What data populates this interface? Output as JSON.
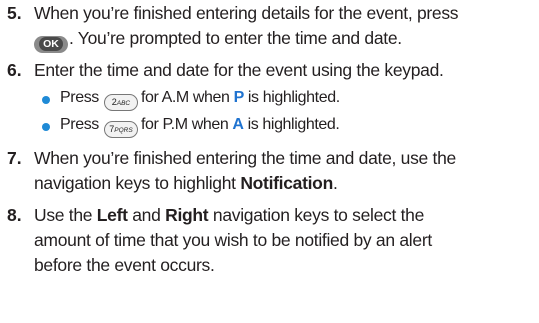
{
  "steps": [
    {
      "number": "5.",
      "lines": [
        "When you’re finished entering details for the event, press",
        ". You’re prompted to enter the time and date."
      ],
      "ok_key_label": "OK"
    },
    {
      "number": "6.",
      "lines": [
        "Enter the time and date for the event using the keypad."
      ],
      "bullets": [
        {
          "before": "Press",
          "key_label": "2",
          "key_letters": "ABC",
          "middle": "for A.M when",
          "highlight": "P",
          "after": "is highlighted."
        },
        {
          "before": "Press",
          "key_label": "7",
          "key_letters": "PQRS",
          "middle": "for P.M when",
          "highlight": "A",
          "after": "is highlighted."
        }
      ]
    },
    {
      "number": "7.",
      "lines": [
        "When you’re finished entering the time and date, use the",
        "navigation keys to highlight",
        "Notification",
        "."
      ]
    },
    {
      "number": "8.",
      "lines": [
        "Use the",
        "Left",
        "and",
        "Right",
        "navigation keys to select the",
        "amount of time that you wish to be notified by an alert",
        "before the event occurs."
      ]
    }
  ],
  "colors": {
    "text": "#231f20",
    "bullet": "#1f8ad6",
    "highlight": "#1f73d0"
  }
}
